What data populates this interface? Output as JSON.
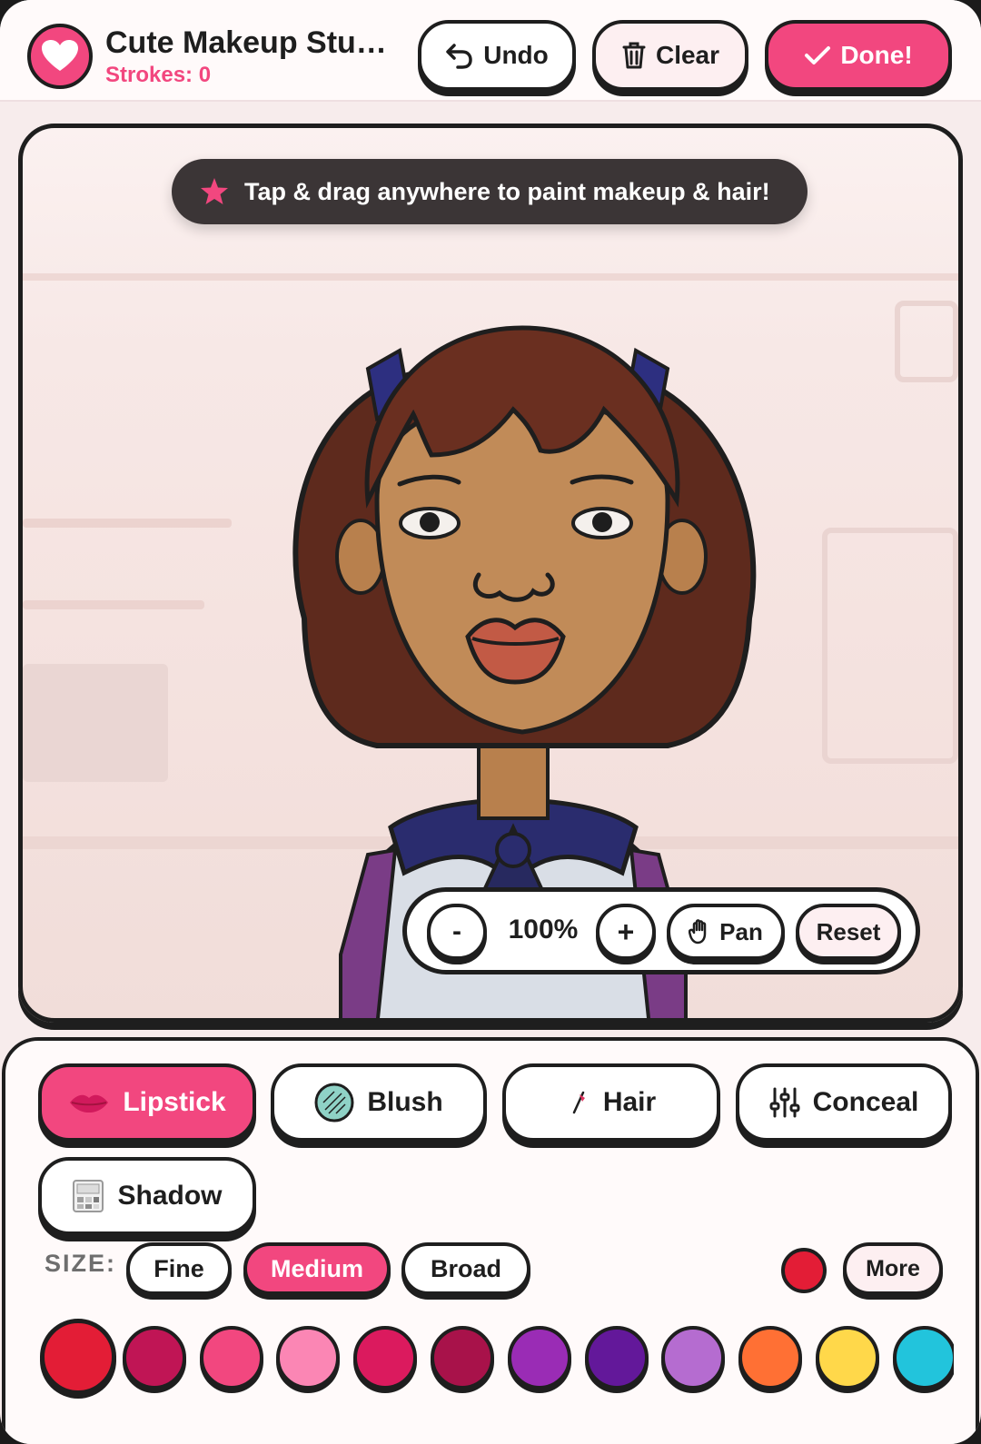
{
  "header": {
    "title": "Cute Makeup Stu…",
    "strokes_label": "Strokes: 0",
    "undo_label": "Undo",
    "clear_label": "Clear",
    "done_label": "Done!"
  },
  "canvas": {
    "hint": "Tap & drag anywhere to paint makeup & hair!",
    "zoom": {
      "minus_label": "-",
      "value": "100%",
      "plus_label": "+",
      "pan_label": "Pan",
      "reset_label": "Reset"
    }
  },
  "tools": {
    "items": [
      {
        "label": "Lipstick",
        "icon": "lips-icon",
        "active": true
      },
      {
        "label": "Blush",
        "icon": "blush-compact-icon",
        "active": false
      },
      {
        "label": "Hair",
        "icon": "hair-brush-icon",
        "active": false
      },
      {
        "label": "Conceal",
        "icon": "sliders-icon",
        "active": false
      },
      {
        "label": "Shadow",
        "icon": "eyeshadow-palette-icon",
        "active": false
      }
    ]
  },
  "size": {
    "label": "SIZE:",
    "options": [
      "Fine",
      "Medium",
      "Broad"
    ],
    "selected": "Medium"
  },
  "color": {
    "current": "#e31d36",
    "more_label": "More",
    "swatches": [
      "#e31d36",
      "#c01555",
      "#f2477f",
      "#fb86b4",
      "#db1a5e",
      "#a8124a",
      "#9a2cb5",
      "#63189a",
      "#b56cd0",
      "#ff7034",
      "#ffd84a",
      "#22c4dc"
    ],
    "selected_index": 0
  },
  "accent": "#f2477f"
}
